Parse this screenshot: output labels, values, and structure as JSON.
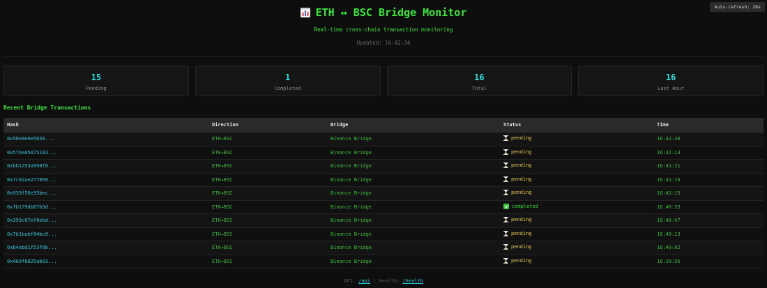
{
  "auto_refresh_label": "Auto-refresh: 20s",
  "header": {
    "title": "ETH ↔ BSC Bridge Monitor",
    "subtitle": "Real-time cross-chain transaction monitoring",
    "updated": "Updated: 16:42:34"
  },
  "stats": [
    {
      "value": "15",
      "label": "Pending"
    },
    {
      "value": "1",
      "label": "Completed"
    },
    {
      "value": "16",
      "label": "Total"
    },
    {
      "value": "16",
      "label": "Last Hour"
    }
  ],
  "section_title": "Recent Bridge Transactions",
  "table": {
    "columns": [
      "Hash",
      "Direction",
      "Bridge",
      "Status",
      "Time"
    ],
    "rows": [
      {
        "hash": "0x50e9e0e5656...",
        "direction": "ETH→BSC",
        "bridge": "Binance Bridge",
        "status": "pending",
        "time": "16:42:30"
      },
      {
        "hash": "0x576a05075183...",
        "direction": "ETH→BSC",
        "bridge": "Binance Bridge",
        "status": "pending",
        "time": "16:42:13"
      },
      {
        "hash": "0xbb1253a998f8...",
        "direction": "ETH→BSC",
        "bridge": "Binance Bridge",
        "status": "pending",
        "time": "16:41:21"
      },
      {
        "hash": "0x7c02ae277050...",
        "direction": "ETH→BSC",
        "bridge": "Binance Bridge",
        "status": "pending",
        "time": "16:41:16"
      },
      {
        "hash": "0x939f56e33bec...",
        "direction": "ETH→BSC",
        "bridge": "Binance Bridge",
        "status": "pending",
        "time": "16:41:15"
      },
      {
        "hash": "0xfb179db67b5d...",
        "direction": "ETH→BSC",
        "bridge": "Binance Bridge",
        "status": "completed",
        "time": "16:40:53"
      },
      {
        "hash": "0x393c07ef0ebd...",
        "direction": "ETH→BSC",
        "bridge": "Binance Bridge",
        "status": "pending",
        "time": "16:40:47"
      },
      {
        "hash": "0x7b1babf84bc0...",
        "direction": "ETH→BSC",
        "bridge": "Binance Bridge",
        "status": "pending",
        "time": "16:40:13"
      },
      {
        "hash": "0xb4abd1f53f0b...",
        "direction": "ETH→BSC",
        "bridge": "Binance Bridge",
        "status": "pending",
        "time": "16:40:02"
      },
      {
        "hash": "0x460f8825ab93...",
        "direction": "ETH→BSC",
        "bridge": "Binance Bridge",
        "status": "pending",
        "time": "16:39:56"
      }
    ]
  },
  "footer": {
    "api_label": "API:",
    "api_link": "/api",
    "separator": "|",
    "health_label": "Health:",
    "health_link": "/health"
  },
  "icons": {
    "title_icon": "bar-chart-icon",
    "pending_icon": "hourglass-icon",
    "completed_icon": "check-icon"
  },
  "colors": {
    "accent_green": "#39e639",
    "accent_cyan": "#2ee0e0",
    "pending_yellow": "#e0c640",
    "background": "#0e0e0e"
  }
}
